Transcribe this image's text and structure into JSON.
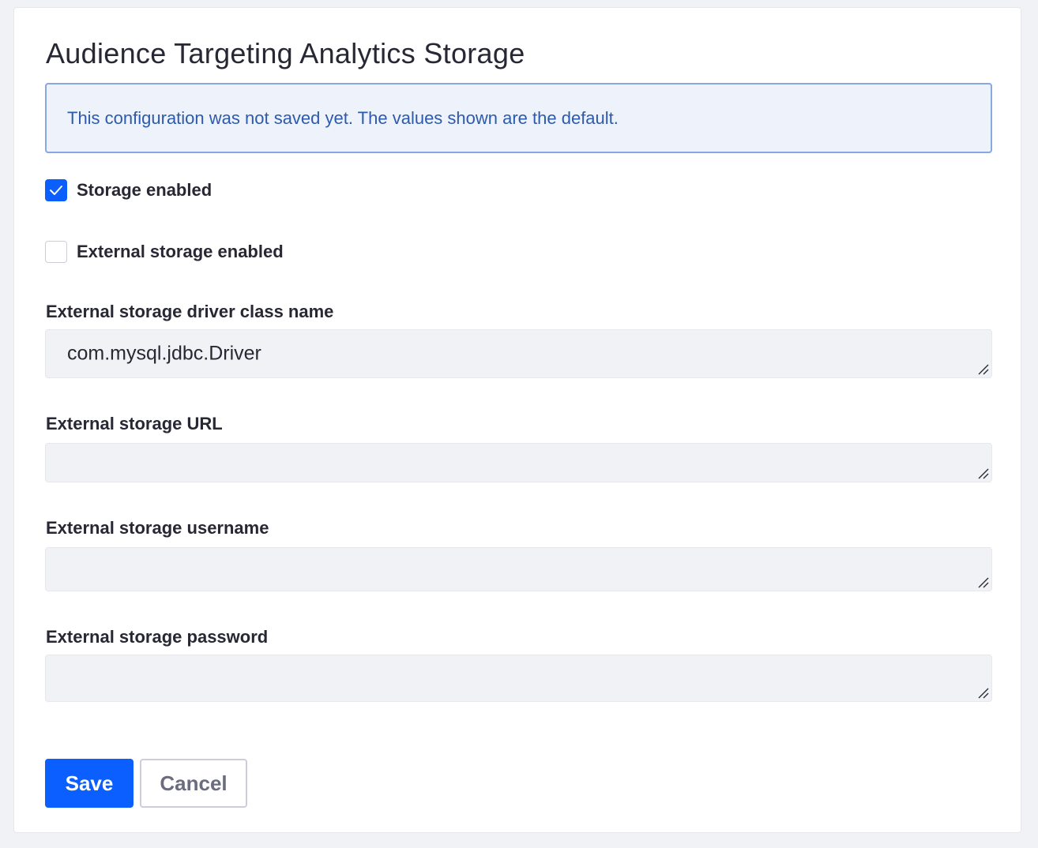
{
  "page": {
    "title": "Audience Targeting Analytics Storage"
  },
  "alert": {
    "message": "This configuration was not saved yet. The values shown are the default."
  },
  "checkboxes": [
    {
      "label": "Storage enabled",
      "checked": true
    },
    {
      "label": "External storage enabled",
      "checked": false
    }
  ],
  "fields": {
    "driver_class": {
      "label": "External storage driver class name",
      "value": "com.mysql.jdbc.Driver"
    },
    "url": {
      "label": "External storage URL",
      "value": ""
    },
    "username": {
      "label": "External storage username",
      "value": ""
    },
    "password": {
      "label": "External storage password",
      "value": ""
    }
  },
  "actions": {
    "save_label": "Save",
    "cancel_label": "Cancel"
  },
  "colors": {
    "primary": "#0b5fff",
    "alert_text": "#2e5aac",
    "alert_border": "#89a7e0",
    "alert_bg": "#eef2fa",
    "input_bg": "#f1f2f5"
  }
}
